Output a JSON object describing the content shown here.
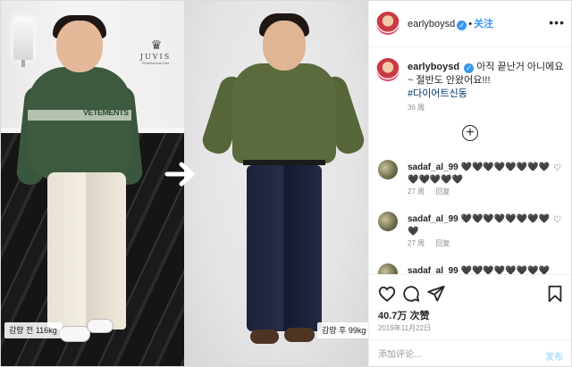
{
  "photo": {
    "logo_brand": "JUVIS",
    "logo_tagline": "Professional Diet",
    "sweater_text": "VETEMENTS",
    "before_label": "감량 전 116kg",
    "after_label": "감량 후 99kg"
  },
  "header": {
    "username": "earlyboysd",
    "verified_glyph": "✓",
    "separator": "•",
    "follow_label": "关注",
    "more_glyph": "•••"
  },
  "caption": {
    "username": "earlyboysd",
    "text": "아직 끝난거 아니에요~ 절반도 안왔어요!!!",
    "hashtag": "#다이어트신동",
    "time": "36 周"
  },
  "load_more_glyph": "+",
  "comments": [
    {
      "username": "sadaf_al_99",
      "text": "🖤🖤🖤🖤🖤🖤🖤🖤🖤🖤🖤🖤🖤",
      "time": "27 周",
      "reply": "回复"
    },
    {
      "username": "sadaf_al_99",
      "text": "🖤🖤🖤🖤🖤🖤🖤🖤🖤",
      "time": "27 周",
      "reply": "回复"
    },
    {
      "username": "sadaf_al_99",
      "text": "🖤🖤🖤🖤🖤🖤🖤🖤🖤",
      "time": "",
      "reply": ""
    }
  ],
  "actions": {
    "likes": "40.7万 次赞",
    "date": "2019年11月22日",
    "comment_placeholder": "添加评论...",
    "post_label": "发布"
  }
}
